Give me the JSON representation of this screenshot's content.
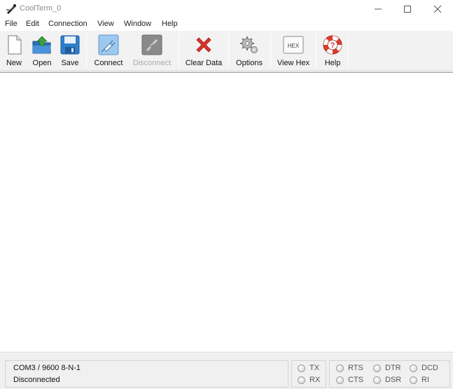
{
  "window": {
    "title": "CoolTerm_0"
  },
  "menu": {
    "items": [
      "File",
      "Edit",
      "Connection",
      "View",
      "Window",
      "Help"
    ]
  },
  "toolbar": {
    "new": "New",
    "open": "Open",
    "save": "Save",
    "connect": "Connect",
    "disconnect": "Disconnect",
    "clear_data": "Clear Data",
    "options": "Options",
    "view_hex": "View Hex",
    "view_hex_icon_text": "HEX",
    "help": "Help"
  },
  "status": {
    "port_settings": "COM3 / 9600 8-N-1",
    "connection_state": "Disconnected"
  },
  "indicators": {
    "tx": "TX",
    "rx": "RX",
    "rts": "RTS",
    "cts": "CTS",
    "dtr": "DTR",
    "dsr": "DSR",
    "dcd": "DCD",
    "ri": "RI"
  },
  "colors": {
    "clear_icon": "#d9342b",
    "help_ring": "#e23b2e",
    "save_icon": "#2f7fcc",
    "open_arrow": "#3aa53a"
  }
}
